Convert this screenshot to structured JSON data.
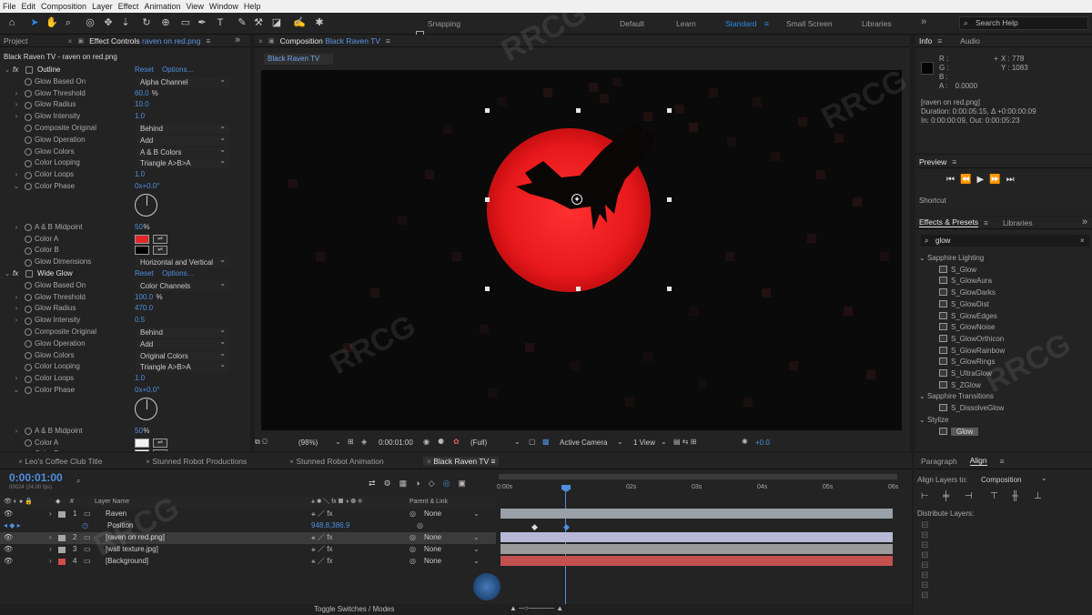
{
  "menubar": {
    "items": [
      "File",
      "Edit",
      "Composition",
      "Layer",
      "Effect",
      "Animation",
      "View",
      "Window",
      "Help"
    ]
  },
  "toolbar": {
    "snapping": "Snapping",
    "workspaces": [
      "Default",
      "Learn",
      "Standard",
      "Small Screen",
      "Libraries"
    ],
    "active_workspace": "Standard",
    "search_help": "Search Help"
  },
  "left_panel": {
    "tabs": [
      "Project",
      "Effect Controls"
    ],
    "effect_target": "raven on red.png",
    "breadcrumb": "Black Raven TV - raven on red.png",
    "reset": "Reset",
    "options": "Options...",
    "effects": [
      {
        "name": "Outline",
        "props": [
          {
            "label": "Glow Based On",
            "dropdown": "Alpha Channel"
          },
          {
            "label": "Glow Threshold",
            "value": "60.0",
            "unit": "%"
          },
          {
            "label": "Glow Radius",
            "value": "10.0"
          },
          {
            "label": "Glow Intensity",
            "value": "1.0"
          },
          {
            "label": "Composite Original",
            "dropdown": "Behind"
          },
          {
            "label": "Glow Operation",
            "dropdown": "Add"
          },
          {
            "label": "Glow Colors",
            "dropdown": "A & B Colors"
          },
          {
            "label": "Color Looping",
            "dropdown": "Triangle A>B>A"
          },
          {
            "label": "Color Loops",
            "value": "1.0"
          },
          {
            "label": "Color Phase",
            "value": "0x+0.0°"
          },
          {
            "label": "A & B Midpoint",
            "value": "50",
            "unit": "%"
          },
          {
            "label": "Color A",
            "color": "#e0272a"
          },
          {
            "label": "Color B",
            "color": "#000000"
          },
          {
            "label": "Glow Dimensions",
            "dropdown": "Horizontal and Vertical"
          }
        ]
      },
      {
        "name": "Wide Glow",
        "props": [
          {
            "label": "Glow Based On",
            "dropdown": "Color Channels"
          },
          {
            "label": "Glow Threshold",
            "value": "100.0",
            "unit": "%"
          },
          {
            "label": "Glow Radius",
            "value": "470.0"
          },
          {
            "label": "Glow Intensity",
            "value": "0.5"
          },
          {
            "label": "Composite Original",
            "dropdown": "Behind"
          },
          {
            "label": "Glow Operation",
            "dropdown": "Add"
          },
          {
            "label": "Glow Colors",
            "dropdown": "Original Colors"
          },
          {
            "label": "Color Looping",
            "dropdown": "Triangle A>B>A"
          },
          {
            "label": "Color Loops",
            "value": "1.0"
          },
          {
            "label": "Color Phase",
            "value": "0x+0.0°"
          },
          {
            "label": "A & B Midpoint",
            "value": "50",
            "unit": "%"
          },
          {
            "label": "Color A",
            "color": "#f2f2f2"
          },
          {
            "label": "Color B",
            "color": "#f2f2f2"
          }
        ]
      }
    ]
  },
  "composition": {
    "tab": "Composition",
    "name": "Black Raven TV",
    "viewer_tab": "Black Raven TV",
    "footer": {
      "zoom": "(98%)",
      "time": "0:00:01:00",
      "resolution": "(Full)",
      "camera": "Active Camera",
      "view": "1 View",
      "exposure": "+0.0"
    }
  },
  "info": {
    "tabs": [
      "Info",
      "Audio"
    ],
    "r": "R :",
    "g": "G :",
    "b": "B :",
    "a": "A :",
    "a_val": "0.0000",
    "x": "X : 778",
    "y": "Y : 1083",
    "file": "[raven on red.png]",
    "duration": "Duration: 0:00:05:15, Δ +0:00:00:09",
    "inout": "In: 0:00:00:09, Out: 0:00:05:23"
  },
  "preview": {
    "tab": "Preview",
    "shortcut": "Shortcut"
  },
  "effects_presets": {
    "tabs": [
      "Effects & Presets",
      "Libraries"
    ],
    "search": "glow",
    "groups": [
      {
        "name": "Sapphire Lighting",
        "items": [
          "S_Glow",
          "S_GlowAura",
          "S_GlowDarks",
          "S_GlowDist",
          "S_GlowEdges",
          "S_GlowNoise",
          "S_GlowOrthicon",
          "S_GlowRainbow",
          "S_GlowRings",
          "S_UltraGlow",
          "S_ZGlow"
        ]
      },
      {
        "name": "Sapphire Transitions",
        "items": [
          "S_DissolveGlow"
        ]
      },
      {
        "name": "Stylize",
        "items": [
          "Glow"
        ]
      }
    ]
  },
  "timeline": {
    "tabs": [
      "Leo's Coffee Club Title",
      "Stunned Robot Productions",
      "Stunned Robot Animation",
      "Black Raven TV"
    ],
    "active_tab": "Black Raven TV",
    "timecode": "0:00:01:00",
    "fps": "00024 (24.00 fps)",
    "header": {
      "layer_name": "Layer Name",
      "parent": "Parent & Link"
    },
    "ruler": [
      "0:00s",
      "02s",
      "03s",
      "04s",
      "05s",
      "06s"
    ],
    "layers": [
      {
        "num": "1",
        "name": "Raven",
        "parent": "None",
        "color": "#a7a7a7"
      },
      {
        "num": "",
        "name": "Position",
        "value": "948.8,386.9"
      },
      {
        "num": "2",
        "name": "[raven on red.png]",
        "parent": "None",
        "color": "#a7a7a7"
      },
      {
        "num": "3",
        "name": "[wall texture.jpg]",
        "parent": "None",
        "color": "#a7a7a7"
      },
      {
        "num": "4",
        "name": "[Background]",
        "parent": "None",
        "color": "#d34b4b"
      }
    ],
    "toggle": "Toggle Switches / Modes"
  },
  "align": {
    "tabs": [
      "Paragraph",
      "Align"
    ],
    "align_to_label": "Align Layers to:",
    "align_to": "Composition",
    "distribute": "Distribute Layers:"
  }
}
